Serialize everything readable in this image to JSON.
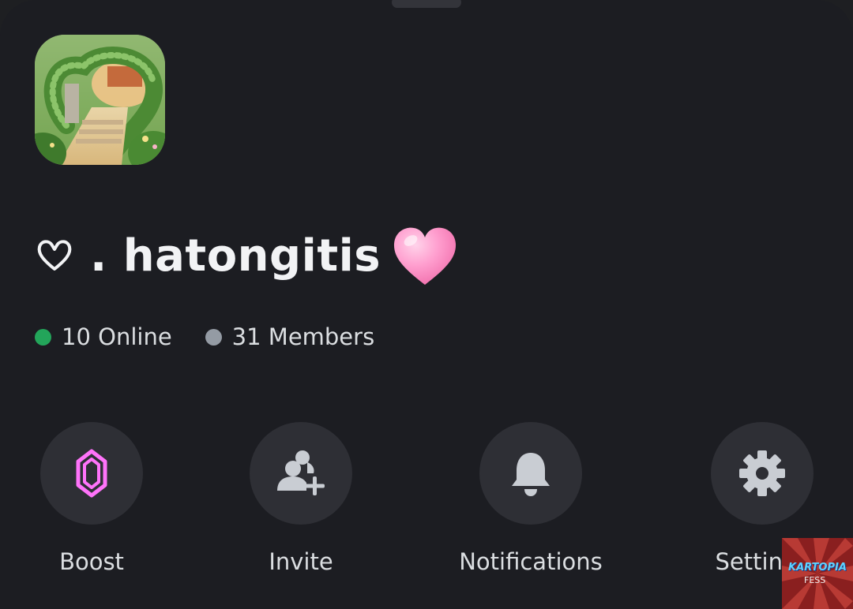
{
  "server": {
    "name": ". hatongitis",
    "icon": "garden-heart-arch-image",
    "name_prefix_icon": "outline-heart-icon",
    "name_suffix_emoji": "pink-heart-emoji"
  },
  "stats": {
    "online_label": "10 Online",
    "members_label": "31 Members",
    "online_color": "#23a55a",
    "members_color": "#949ba4"
  },
  "actions": [
    {
      "label": "Boost",
      "icon": "boost-gem-icon",
      "color": "#ff73fa"
    },
    {
      "label": "Invite",
      "icon": "add-user-icon"
    },
    {
      "label": "Notifications",
      "icon": "bell-icon"
    },
    {
      "label": "Settings",
      "icon": "gear-icon"
    }
  ],
  "watermark": {
    "title": "KARTOPIA",
    "sub": "FESS"
  }
}
